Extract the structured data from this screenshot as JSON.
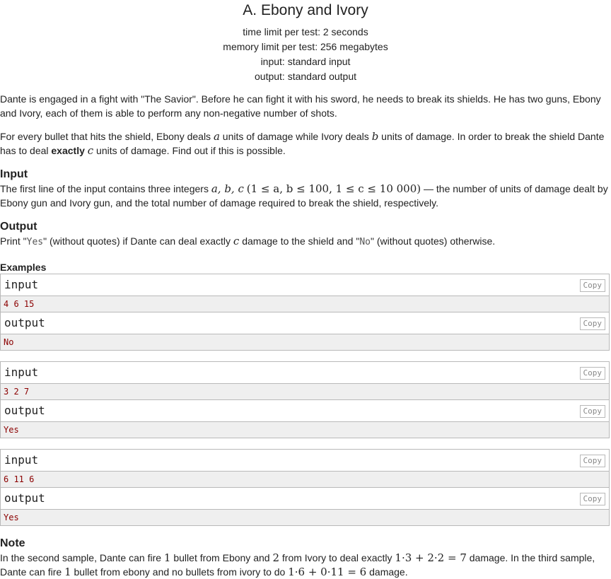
{
  "problem": {
    "title": "A. Ebony and Ivory",
    "time_limit": "time limit per test: 2 seconds",
    "memory_limit": "memory limit per test: 256 megabytes",
    "input_file": "input: standard input",
    "output_file": "output: standard output"
  },
  "statement": {
    "p1": "Dante is engaged in a fight with \"The Savior\". Before he can fight it with his sword, he needs to break its shields. He has two guns, Ebony and Ivory, each of them is able to perform any non-negative number of shots.",
    "p2_a": "For every bullet that hits the shield, Ebony deals ",
    "p2_var_a": "a",
    "p2_b": " units of damage while Ivory deals ",
    "p2_var_b": "b",
    "p2_c": " units of damage. In order to break the shield Dante has to deal ",
    "p2_bold": "exactly",
    "p2_var_c": "c",
    "p2_d": " units of damage. Find out if this is possible."
  },
  "input_section": {
    "title": "Input",
    "text_a": "The first line of the input contains three integers ",
    "math_vars": "a, b, c",
    "math_constraint": "(1 ≤ a, b ≤ 100, 1 ≤ c ≤ 10 000)",
    "text_b": " — the number of units of damage dealt by Ebony gun and Ivory gun, and the total number of damage required to break the shield, respectively."
  },
  "output_section": {
    "title": "Output",
    "text_a": "Print \"",
    "yes_token": "Yes",
    "text_b": "\" (without quotes) if Dante can deal exactly ",
    "var_c": "c",
    "text_c": " damage to the shield and \"",
    "no_token": "No",
    "text_d": "\" (without quotes) otherwise."
  },
  "examples": {
    "title": "Examples",
    "input_label": "input",
    "output_label": "output",
    "copy_label": "Copy",
    "items": [
      {
        "input": "4 6 15",
        "output": "No"
      },
      {
        "input": "3 2 7",
        "output": "Yes"
      },
      {
        "input": "6 11 6",
        "output": "Yes"
      }
    ]
  },
  "note": {
    "title": "Note",
    "t1": "In the second sample, Dante can fire ",
    "m1": "1",
    "t2": " bullet from Ebony and ",
    "m2": "2",
    "t3": " from Ivory to deal exactly ",
    "m3": "1·3 + 2·2 = 7",
    "t4": " damage. In the third sample, Dante can fire ",
    "m4": "1",
    "t5": " bullet from ebony and no bullets from ivory to do ",
    "m5": "1·6 + 0·11 = 6",
    "t6": " damage."
  }
}
